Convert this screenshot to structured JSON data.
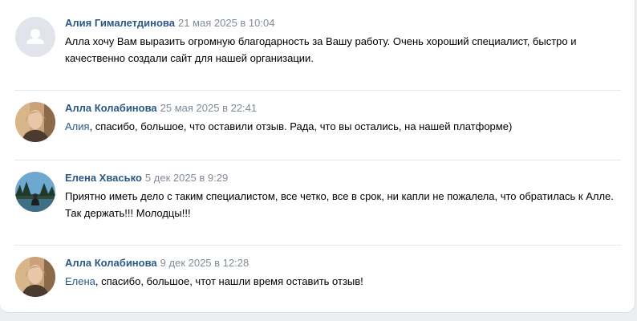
{
  "comments": [
    {
      "author": "Алия Гималетдинова",
      "date": "21 мая 2025 в 10:04",
      "avatar": "default-avatar-icon",
      "text_line1": "Алла хочу Вам выразить огромную благодарность за Вашу работу. Очень хороший специалист, быстро и",
      "text_line2": "качественно создали сайт для нашей организации."
    },
    {
      "author": "Алла Колабинова",
      "date": "25 мая 2025 в 22:41",
      "avatar": "user-photo-alla",
      "mention": "Алия",
      "text_line1": ", спасибо, большое, что оставили отзыв. Рада, что вы остались, на нашей платформе)"
    },
    {
      "author": "Елена Хвасько",
      "date": "5 дек 2025 в 9:29",
      "avatar": "user-photo-elena",
      "text_line1": "Приятно иметь дело с таким специалистом, все четко, все в срок, ни капли не пожалела, что обратилась к Алле.",
      "text_line2": "Так держать!!! Молодцы!!!"
    },
    {
      "author": "Алла Колабинова",
      "date": "9 дек 2025 в 12:28",
      "avatar": "user-photo-alla",
      "mention": "Елена",
      "text_line1": ", спасибо, большое, чтот нашли время оставить отзыв!"
    }
  ],
  "colors": {
    "author_link": "#2a5885",
    "date": "#818c99",
    "divider": "#e7e8ec",
    "page_bg": "#edeef0"
  }
}
